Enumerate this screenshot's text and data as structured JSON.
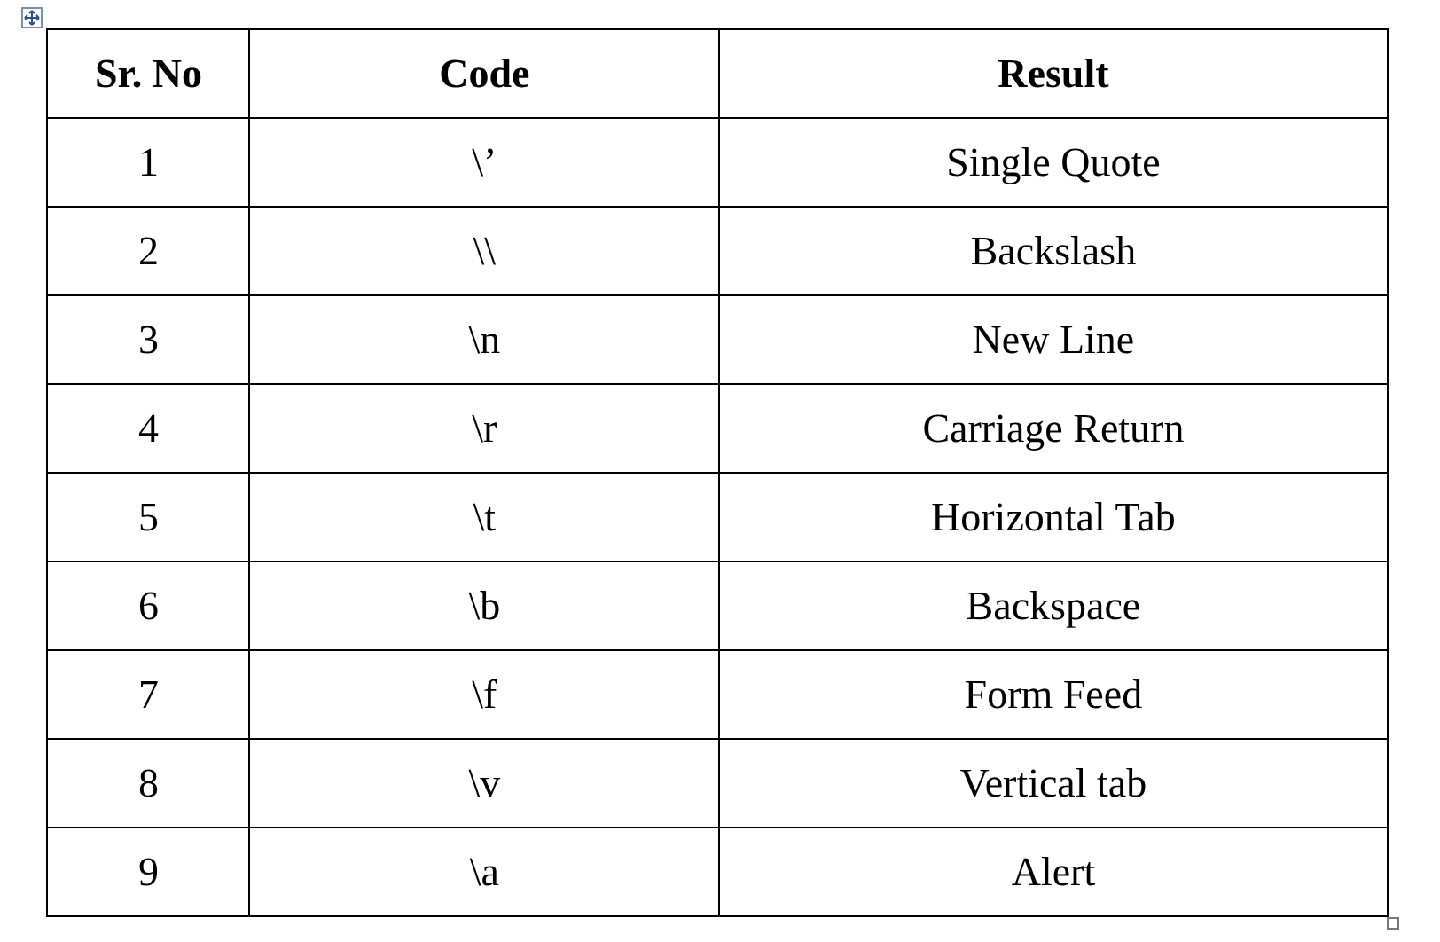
{
  "table": {
    "columns": [
      "Sr. No",
      "Code",
      "Result"
    ],
    "rows": [
      [
        "1",
        "\\’",
        "Single Quote"
      ],
      [
        "2",
        "\\\\",
        "Backslash"
      ],
      [
        "3",
        "\\n",
        "New Line"
      ],
      [
        "4",
        "\\r",
        "Carriage Return"
      ],
      [
        "5",
        "\\t",
        "Horizontal Tab"
      ],
      [
        "6",
        "\\b",
        "Backspace"
      ],
      [
        "7",
        "\\f",
        "Form Feed"
      ],
      [
        "8",
        "\\v",
        "Vertical tab"
      ],
      [
        "9",
        "\\a",
        "Alert"
      ]
    ]
  }
}
